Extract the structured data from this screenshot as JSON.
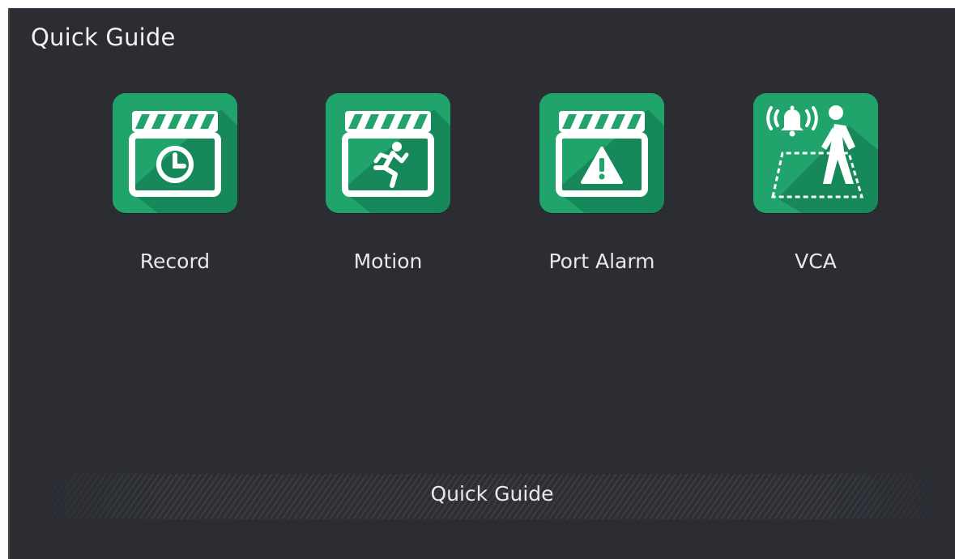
{
  "window": {
    "title": "Quick Guide"
  },
  "tiles": [
    {
      "label": "Record",
      "icon": "clapperboard-clock-icon"
    },
    {
      "label": "Motion",
      "icon": "clapperboard-running-person-icon"
    },
    {
      "label": "Port Alarm",
      "icon": "clapperboard-warning-icon"
    },
    {
      "label": "VCA",
      "icon": "alarm-bell-walking-person-icon"
    }
  ],
  "footer": {
    "label": "Quick Guide"
  },
  "colors": {
    "background": "#2b2d33",
    "icon_green": "#20a46c",
    "icon_shadow": "#15824f",
    "text": "#e8e8e8"
  }
}
